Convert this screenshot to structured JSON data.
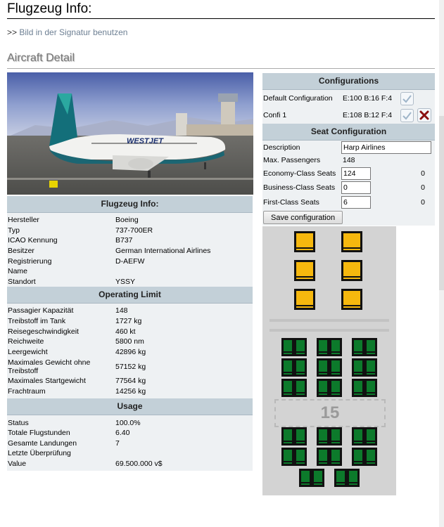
{
  "page": {
    "title": "Flugzeug Info:",
    "signature_prefix": ">>",
    "signature_link": "Bild in der Signatur benutzen",
    "section_title": "Aircraft Detail"
  },
  "photo": {
    "livery_text": "WESTJET"
  },
  "info": {
    "header": "Flugzeug Info:",
    "rows": [
      {
        "label": "Hersteller",
        "value": "Boeing"
      },
      {
        "label": "Typ",
        "value": "737-700ER"
      },
      {
        "label": "ICAO Kennung",
        "value": "B737"
      },
      {
        "label": "Besitzer",
        "value": "German International Airlines"
      },
      {
        "label": "Registrierung",
        "value": "D-AEFW"
      },
      {
        "label": "Name",
        "value": ""
      },
      {
        "label": "Standort",
        "value": "YSSY"
      }
    ]
  },
  "operating": {
    "header": "Operating Limit",
    "rows": [
      {
        "label": "Passagier Kapazität",
        "value": "148"
      },
      {
        "label": "Treibstoff im Tank",
        "value": "1727 kg"
      },
      {
        "label": "Reisegeschwindigkeit",
        "value": "460 kt"
      },
      {
        "label": "Reichweite",
        "value": "5800 nm"
      },
      {
        "label": "Leergewicht",
        "value": "42896 kg"
      },
      {
        "label": "Maximales Gewicht ohne Treibstoff",
        "value": "57152 kg"
      },
      {
        "label": "Maximales Startgewicht",
        "value": "77564 kg"
      },
      {
        "label": "Frachtraum",
        "value": "14256 kg"
      }
    ]
  },
  "usage": {
    "header": "Usage",
    "rows": [
      {
        "label": "Status",
        "value": "100.0%"
      },
      {
        "label": "Totale Flugstunden",
        "value": "6.40"
      },
      {
        "label": "Gesamte Landungen",
        "value": "7"
      },
      {
        "label": "Letzte Überprüfung",
        "value": ""
      },
      {
        "label": "Value",
        "value": "69.500.000 v$"
      }
    ]
  },
  "configurations": {
    "header": "Configurations",
    "items": [
      {
        "name": "Default Configuration",
        "value": "E:100 B:16 F:4",
        "check_icon": "check-icon",
        "deletable": false
      },
      {
        "name": "Confi 1",
        "value": "E:108 B:12 F:4",
        "check_icon": "check-icon",
        "deletable": true
      }
    ]
  },
  "seat_config": {
    "header": "Seat Configuration",
    "description_label": "Description",
    "description_value": "Harp Airlines",
    "max_label": "Max. Passengers",
    "max_value": "148",
    "economy_label": "Economy-Class Seats",
    "economy_value": "124",
    "economy_remaining": "0",
    "business_label": "Business-Class Seats",
    "business_value": "0",
    "business_remaining": "0",
    "first_label": "First-Class Seats",
    "first_value": "6",
    "first_remaining": "0",
    "save_label": "Save configuration"
  },
  "seatmap": {
    "row_number": "15",
    "first_color": "#f6b80e",
    "economy_color": "#0c7a2b"
  }
}
